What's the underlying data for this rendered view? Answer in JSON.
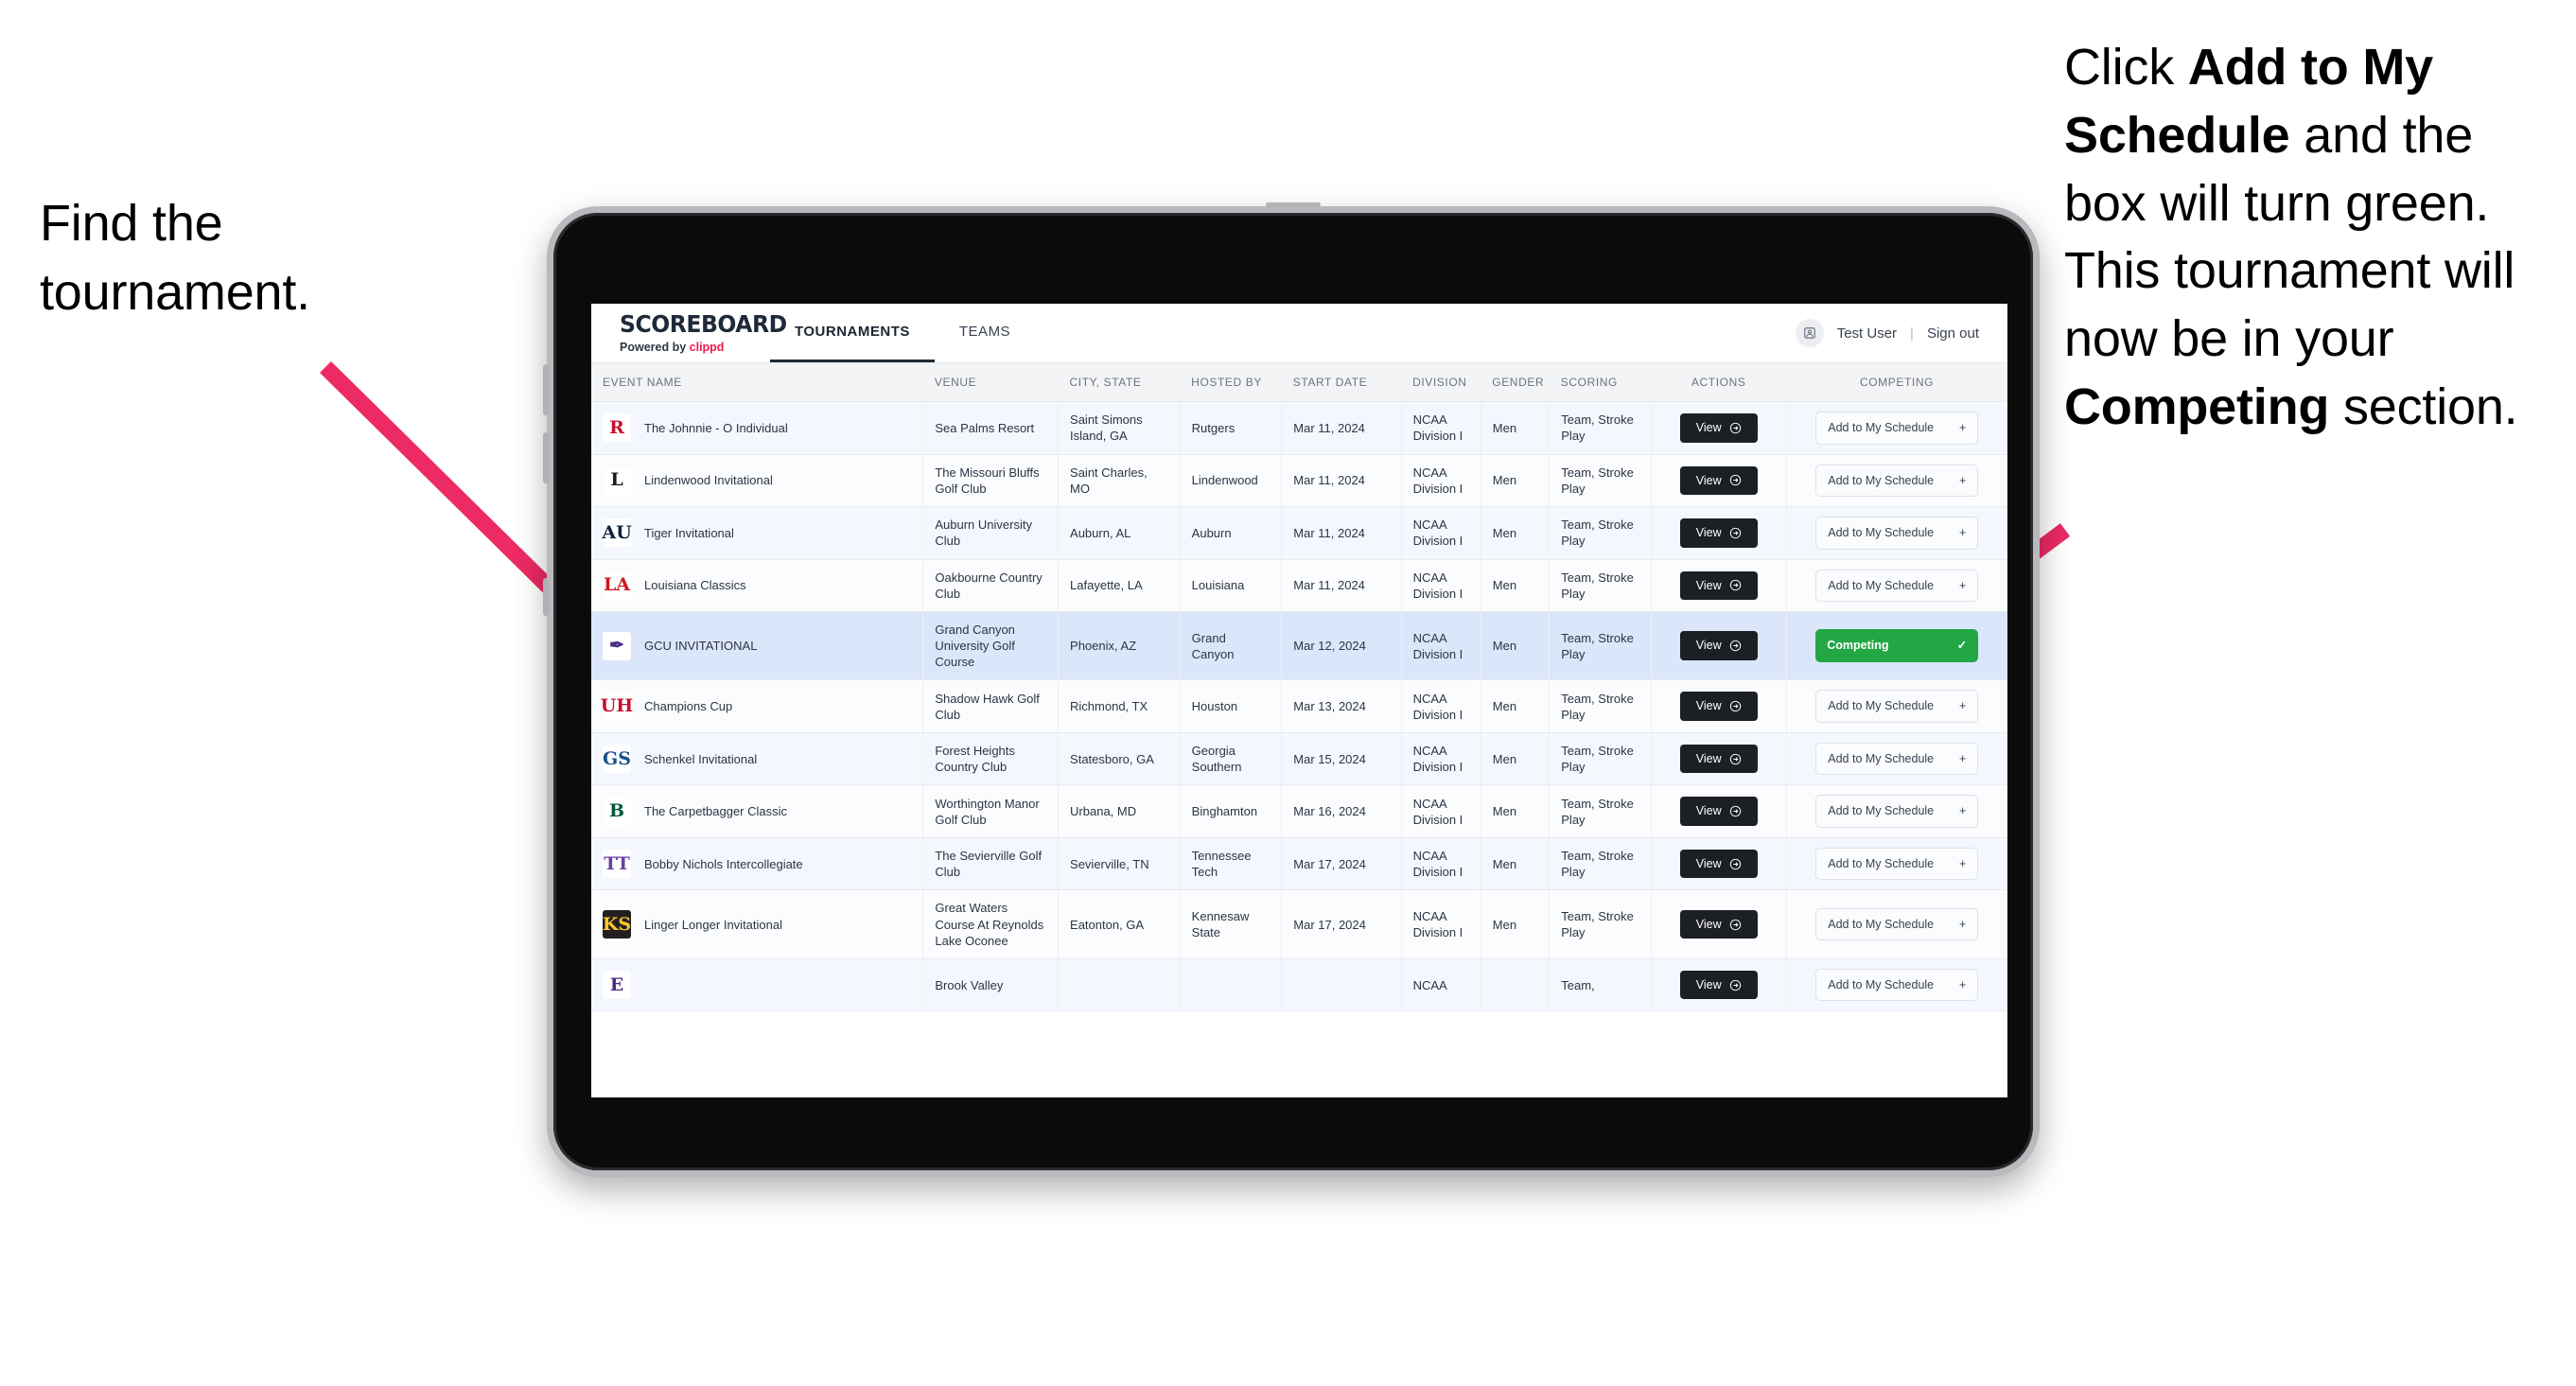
{
  "annotations": {
    "left": {
      "line1": "Find the",
      "line2": "tournament."
    },
    "right": {
      "part1": "Click ",
      "bold1": "Add to My Schedule",
      "part2": " and the box will turn green. This tournament will now be in your ",
      "bold2": "Competing",
      "part3": " section."
    },
    "arrow_color": "#ec2a63"
  },
  "app": {
    "brand": {
      "title": "SCOREBOARD",
      "powered_prefix": "Powered by ",
      "powered_brand": "clippd"
    },
    "tabs": [
      {
        "label": "TOURNAMENTS",
        "active": true
      },
      {
        "label": "TEAMS",
        "active": false
      }
    ],
    "user": {
      "name": "Test User",
      "separator": "|",
      "sign_out": "Sign out",
      "avatar_icon": "user-avatar-icon"
    }
  },
  "table": {
    "columns": [
      "EVENT NAME",
      "VENUE",
      "CITY, STATE",
      "HOSTED BY",
      "START DATE",
      "DIVISION",
      "GENDER",
      "SCORING",
      "ACTIONS",
      "COMPETING"
    ],
    "action_label": "View",
    "add_label": "Add to My Schedule",
    "add_plus": "+",
    "competing_label": "Competing",
    "competing_check": "✓",
    "rows": [
      {
        "logo_text": "R",
        "logo_fg": "#c8102e",
        "logo_bg": "#ffffff",
        "event": "The Johnnie - O Individual",
        "venue": "Sea Palms Resort",
        "city": "Saint Simons Island, GA",
        "host": "Rutgers",
        "date": "Mar 11, 2024",
        "division": "NCAA Division I",
        "gender": "Men",
        "scoring": "Team, Stroke Play",
        "competing": false,
        "selected": false
      },
      {
        "logo_text": "L",
        "logo_fg": "#1a1a1a",
        "logo_bg": "#ffffff",
        "event": "Lindenwood Invitational",
        "venue": "The Missouri Bluffs Golf Club",
        "city": "Saint Charles, MO",
        "host": "Lindenwood",
        "date": "Mar 11, 2024",
        "division": "NCAA Division I",
        "gender": "Men",
        "scoring": "Team, Stroke Play",
        "competing": false,
        "selected": false
      },
      {
        "logo_text": "AU",
        "logo_fg": "#0c2340",
        "logo_bg": "#ffffff",
        "event": "Tiger Invitational",
        "venue": "Auburn University Club",
        "city": "Auburn, AL",
        "host": "Auburn",
        "date": "Mar 11, 2024",
        "division": "NCAA Division I",
        "gender": "Men",
        "scoring": "Team, Stroke Play",
        "competing": false,
        "selected": false
      },
      {
        "logo_text": "LA",
        "logo_fg": "#ce181e",
        "logo_bg": "#ffffff",
        "event": "Louisiana Classics",
        "venue": "Oakbourne Country Club",
        "city": "Lafayette, LA",
        "host": "Louisiana",
        "date": "Mar 11, 2024",
        "division": "NCAA Division I",
        "gender": "Men",
        "scoring": "Team, Stroke Play",
        "competing": false,
        "selected": false
      },
      {
        "logo_text": "✒",
        "logo_fg": "#4b2e83",
        "logo_bg": "#ffffff",
        "event": "GCU INVITATIONAL",
        "venue": "Grand Canyon University Golf Course",
        "city": "Phoenix, AZ",
        "host": "Grand Canyon",
        "date": "Mar 12, 2024",
        "division": "NCAA Division I",
        "gender": "Men",
        "scoring": "Team, Stroke Play",
        "competing": true,
        "selected": true
      },
      {
        "logo_text": "UH",
        "logo_fg": "#c8102e",
        "logo_bg": "#ffffff",
        "event": "Champions Cup",
        "venue": "Shadow Hawk Golf Club",
        "city": "Richmond, TX",
        "host": "Houston",
        "date": "Mar 13, 2024",
        "division": "NCAA Division I",
        "gender": "Men",
        "scoring": "Team, Stroke Play",
        "competing": false,
        "selected": false
      },
      {
        "logo_text": "GS",
        "logo_fg": "#1a4f8b",
        "logo_bg": "#ffffff",
        "event": "Schenkel Invitational",
        "venue": "Forest Heights Country Club",
        "city": "Statesboro, GA",
        "host": "Georgia Southern",
        "date": "Mar 15, 2024",
        "division": "NCAA Division I",
        "gender": "Men",
        "scoring": "Team, Stroke Play",
        "competing": false,
        "selected": false
      },
      {
        "logo_text": "B",
        "logo_fg": "#00563f",
        "logo_bg": "#ffffff",
        "event": "The Carpetbagger Classic",
        "venue": "Worthington Manor Golf Club",
        "city": "Urbana, MD",
        "host": "Binghamton",
        "date": "Mar 16, 2024",
        "division": "NCAA Division I",
        "gender": "Men",
        "scoring": "Team, Stroke Play",
        "competing": false,
        "selected": false
      },
      {
        "logo_text": "TT",
        "logo_fg": "#6b3fa0",
        "logo_bg": "#ffffff",
        "event": "Bobby Nichols Intercollegiate",
        "venue": "The Sevierville Golf Club",
        "city": "Sevierville, TN",
        "host": "Tennessee Tech",
        "date": "Mar 17, 2024",
        "division": "NCAA Division I",
        "gender": "Men",
        "scoring": "Team, Stroke Play",
        "competing": false,
        "selected": false
      },
      {
        "logo_text": "KS",
        "logo_fg": "#ffc629",
        "logo_bg": "#231f20",
        "event": "Linger Longer Invitational",
        "venue": "Great Waters Course At Reynolds Lake Oconee",
        "city": "Eatonton, GA",
        "host": "Kennesaw State",
        "date": "Mar 17, 2024",
        "division": "NCAA Division I",
        "gender": "Men",
        "scoring": "Team, Stroke Play",
        "competing": false,
        "selected": false
      },
      {
        "logo_text": "E",
        "logo_fg": "#4b2e83",
        "logo_bg": "#ffffff",
        "event": "",
        "venue": "Brook Valley",
        "city": "",
        "host": "",
        "date": "",
        "division": "NCAA",
        "gender": "",
        "scoring": "Team,",
        "competing": false,
        "selected": false
      }
    ]
  }
}
